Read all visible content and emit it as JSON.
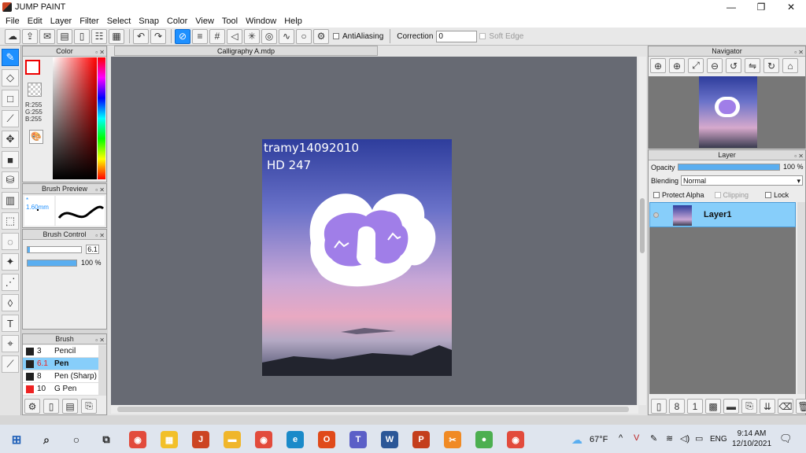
{
  "app": {
    "title": "JUMP PAINT"
  },
  "window_controls": {
    "minimize": "—",
    "maximize": "❐",
    "close": "✕"
  },
  "menu": [
    "File",
    "Edit",
    "Layer",
    "Filter",
    "Select",
    "Snap",
    "Color",
    "View",
    "Tool",
    "Window",
    "Help"
  ],
  "toolbar": {
    "antialiasing_label": "AntiAliasing",
    "correction_label": "Correction",
    "correction_value": "0",
    "soft_edge_label": "Soft Edge"
  },
  "color_panel": {
    "title": "Color",
    "r": "R:255",
    "g": "G:255",
    "b": "B:255",
    "current_color": "#ff0000"
  },
  "brush_preview": {
    "title": "Brush Preview",
    "size": "1.60mm"
  },
  "brush_control": {
    "title": "Brush Control",
    "size_value": "6.1",
    "opacity_value": "100 %",
    "opacity_level": 1.0
  },
  "brush_list": {
    "title": "Brush",
    "items": [
      {
        "size": "3",
        "name": "Pencil",
        "selected": false
      },
      {
        "size": "6.1",
        "name": "Pen",
        "selected": true
      },
      {
        "size": "8",
        "name": "Pen (Sharp)",
        "selected": false
      },
      {
        "size": "10",
        "name": "G Pen",
        "selected": false
      }
    ]
  },
  "document": {
    "tab_title": "Calligraphy A.mdp",
    "handwriting_line1": "tramy14092010",
    "handwriting_line2": "HD 247"
  },
  "navigator": {
    "title": "Navigator"
  },
  "layer_panel": {
    "title": "Layer",
    "opacity_label": "Opacity",
    "opacity_value": "100 %",
    "opacity_level": 1.0,
    "blending_label": "Blending",
    "blending_value": "Normal",
    "protect_alpha_label": "Protect Alpha",
    "clipping_label": "Clipping",
    "lock_label": "Lock",
    "layers": [
      {
        "name": "Layer1",
        "selected": true
      }
    ]
  },
  "taskbar": {
    "weather": "67°F",
    "language": "ENG",
    "time": "9:14 AM",
    "date": "12/10/2021",
    "pinned": [
      "chrome-icon",
      "photos-icon",
      "jumppaint-icon",
      "explorer-icon",
      "chrome-icon",
      "edge-icon",
      "office-icon",
      "teams-icon",
      "word-icon",
      "powerpoint-icon",
      "snip-icon",
      "recorder-icon",
      "chrome-icon"
    ]
  },
  "colors": {
    "accent": "#1e90ff",
    "canvas_bg": "#676a73",
    "selection": "#87cefa",
    "letter_fill": "#a07ee8"
  }
}
